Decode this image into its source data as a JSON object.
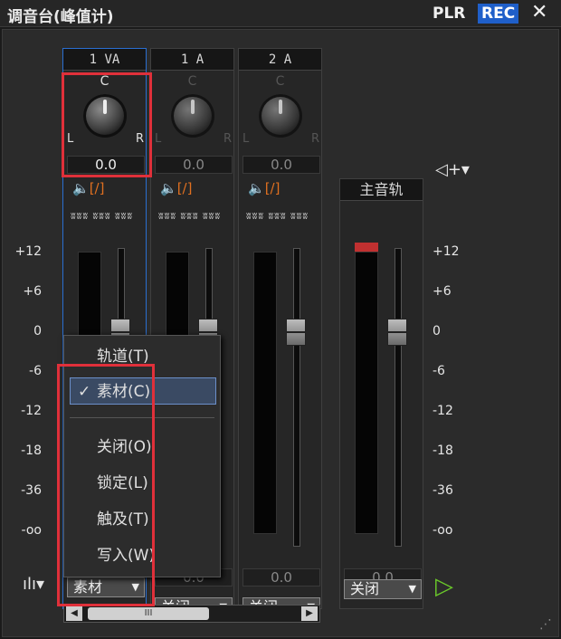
{
  "window": {
    "title": "调音台(峰值计)",
    "plr": "PLR",
    "rec": "REC",
    "close": "✕"
  },
  "tracks": [
    {
      "name": "1 VA",
      "center": "C",
      "left": "L",
      "right": "R",
      "pan": "0.0",
      "zero": "0.0",
      "mode": "素材"
    },
    {
      "name": "1 A",
      "center": "C",
      "left": "L",
      "right": "R",
      "pan": "0.0",
      "zero": "0.0",
      "mode": "关闭"
    },
    {
      "name": "2 A",
      "center": "C",
      "left": "L",
      "right": "R",
      "pan": "0.0",
      "zero": "0.0",
      "mode": "关闭"
    }
  ],
  "master": {
    "name": "主音轨",
    "zero": "0.0",
    "mode": "关闭"
  },
  "scale_left": [
    "+12",
    "+6",
    "0",
    "-6",
    "-12",
    "-18",
    "-36",
    "-oo"
  ],
  "scale_right": [
    "+12",
    "+6",
    "0",
    "-6",
    "-12",
    "-18",
    "-36",
    "-oo"
  ],
  "menu": {
    "items": [
      "轨道(T)",
      "素材(C)",
      "关闭(O)",
      "锁定(L)",
      "触及(T)",
      "写入(W)"
    ],
    "checked": "素材(C)"
  },
  "icons": {
    "speaker": "speaker-mute-icon",
    "mixer": "mixer-settings-icon",
    "play": "play-triangle-icon",
    "graph": "level-graph-icon"
  },
  "colors": {
    "rec_blue": "#1f5fc9",
    "highlight_red": "#e0303a",
    "play_green": "#6ac82a"
  }
}
